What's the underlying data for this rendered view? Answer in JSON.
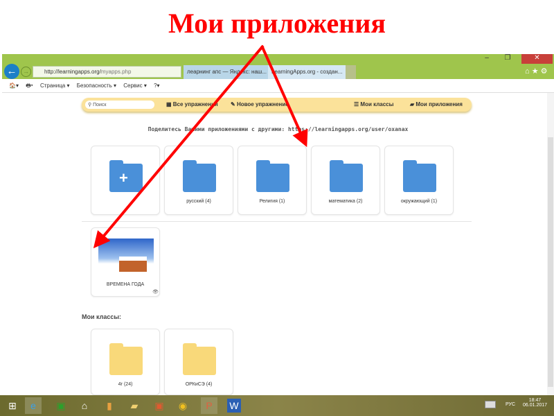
{
  "slide_title": "Мои приложения",
  "browser": {
    "address_host": "http://learningapps.org/",
    "address_path": "myapps.php",
    "tabs": [
      {
        "label": "леарнинг апс — Яндекс: наш..."
      },
      {
        "label": "LearningApps.org - создан..."
      }
    ],
    "command_bar": [
      "Страница ▾",
      "Безопасность ▾",
      "Сервис ▾"
    ]
  },
  "navbar": {
    "search_placeholder": "Поиск",
    "all_exercises": "Все упражнения",
    "new_exercise": "Новое упражнение",
    "my_classes": "Мои классы",
    "my_apps": "Мои приложения"
  },
  "share_text": "Поделитесь Вашими приложениями с другими: https://learningapps.org/user/oxanax",
  "folders": [
    {
      "label": "русский (4)"
    },
    {
      "label": "Религия (1)"
    },
    {
      "label": "математика (2)"
    },
    {
      "label": "окружающий (1)"
    }
  ],
  "app": {
    "label": "ВРЕМЕНА ГОДА"
  },
  "classes_heading": "Мои классы:",
  "classes": [
    {
      "label": "4г (24)"
    },
    {
      "label": "ОРКиСЭ (4)"
    }
  ],
  "taskbar": {
    "lang": "РУС",
    "time": "18:47",
    "date": "06.01.2017"
  },
  "colors": {
    "blue_folder": "#4a90d9",
    "yellow_folder": "#f9d97a",
    "arrow": "#ff0000",
    "chrome": "#9fc54c"
  }
}
